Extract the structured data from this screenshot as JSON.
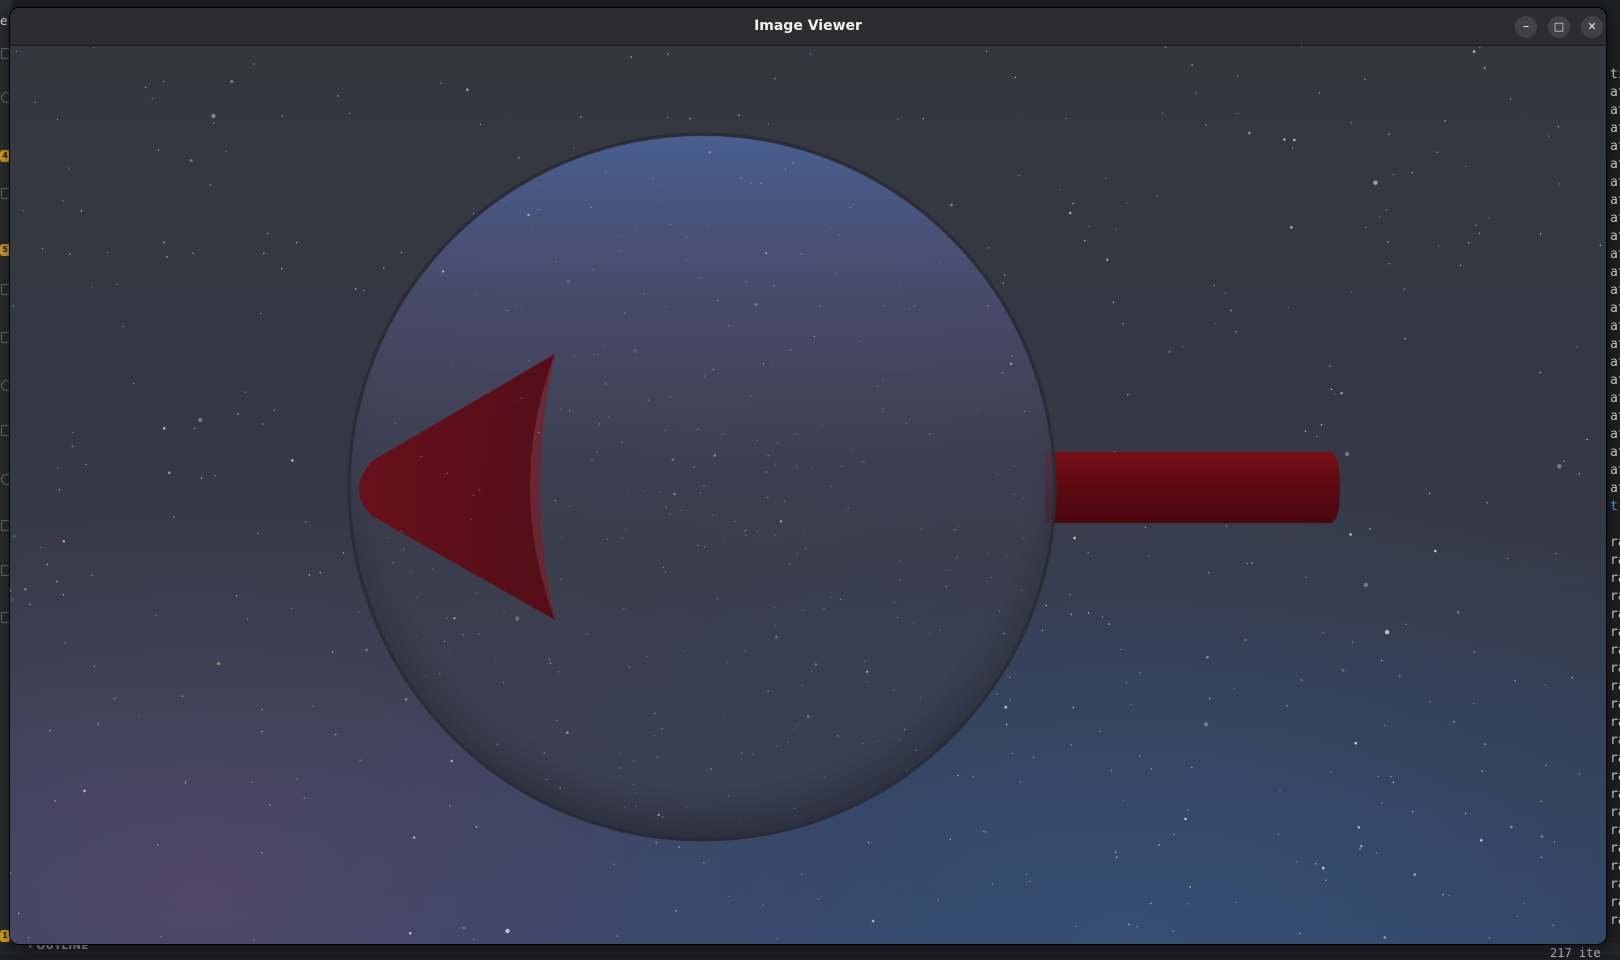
{
  "window": {
    "title": "Image Viewer",
    "minimize_label": "–",
    "maximize_label": "□",
    "close_label": "✕"
  },
  "background_editor": {
    "top_stub": "e",
    "badges": [
      "4",
      "5",
      "1"
    ],
    "outline_label": "OUTLINE",
    "items_label": "217 ite",
    "code_fragments": [
      "ti",
      "at",
      "at",
      "at",
      "at",
      "at",
      "at",
      "at",
      "at",
      "at",
      "at",
      "at",
      "at",
      "at",
      "at",
      "at",
      "at",
      "at",
      "at",
      "at",
      "at",
      "at",
      "at",
      "at",
      "t",
      "",
      "ra",
      "ra",
      "ra",
      "ra",
      "ra",
      "ra",
      "ra",
      "ra",
      "ra",
      "ra",
      "ra",
      "ra",
      "ra",
      "ra",
      "ra",
      "ra",
      "ra",
      "ra",
      "ra",
      "ra",
      "ra",
      "ra"
    ]
  },
  "scene": {
    "description_colors": {
      "sky_top": "#34373f",
      "sky_bottom": "#2f3b55",
      "sphere_glass": "#4a4f63",
      "arrow_red": "#6a0b14"
    },
    "icons": [
      "minimize-icon",
      "maximize-icon",
      "close-icon"
    ]
  }
}
